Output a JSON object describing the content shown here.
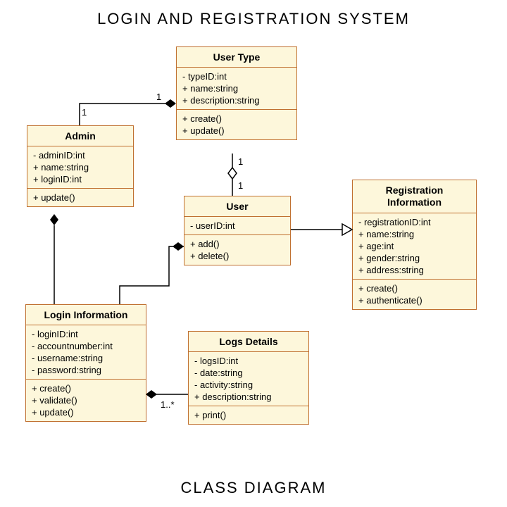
{
  "title": "LOGIN AND REGISTRATION SYSTEM",
  "footer": "CLASS DIAGRAM",
  "classes": {
    "admin": {
      "name": "Admin",
      "attrs": [
        "- adminID:int",
        "+ name:string",
        "+ loginID:int"
      ],
      "ops": [
        "+ update()"
      ]
    },
    "usertype": {
      "name": "User Type",
      "attrs": [
        "- typeID:int",
        "+ name:string",
        "+ description:string"
      ],
      "ops": [
        "+ create()",
        "+ update()"
      ]
    },
    "user": {
      "name": "User",
      "attrs": [
        "- userID:int"
      ],
      "ops": [
        "+ add()",
        "+ delete()"
      ]
    },
    "registration": {
      "name": "Registration Information",
      "attrs": [
        "- registrationID:int",
        "+ name:string",
        "+ age:int",
        "+ gender:string",
        "+ address:string"
      ],
      "ops": [
        "+ create()",
        "+ authenticate()"
      ]
    },
    "login": {
      "name": "Login Information",
      "attrs": [
        "- loginID:int",
        "- accountnumber:int",
        "- username:string",
        "- password:string"
      ],
      "ops": [
        "+ create()",
        "+ validate()",
        "+ update()"
      ]
    },
    "logs": {
      "name": "Logs Details",
      "attrs": [
        "- logsID:int",
        "- date:string",
        "- activity:string",
        "+ description:string"
      ],
      "ops": [
        "+ print()"
      ]
    }
  },
  "multiplicities": {
    "admin_usertype_admin": "1",
    "admin_usertype_type": "1",
    "usertype_user_type": "1",
    "usertype_user_user": "1",
    "login_logs": "1..*"
  },
  "relationships": [
    {
      "from": "Admin",
      "to": "User Type",
      "type": "composition",
      "owner": "User Type",
      "mult_from": "1",
      "mult_to": "1"
    },
    {
      "from": "User Type",
      "to": "User",
      "type": "aggregation",
      "owner": "User",
      "mult_from": "1",
      "mult_to": "1"
    },
    {
      "from": "User",
      "to": "Registration Information",
      "type": "generalization",
      "direction": "User extends Registration Information"
    },
    {
      "from": "Login Information",
      "to": "Admin",
      "type": "composition",
      "owner": "Admin"
    },
    {
      "from": "Login Information",
      "to": "User",
      "type": "composition",
      "owner": "User"
    },
    {
      "from": "Login Information",
      "to": "Logs Details",
      "type": "composition",
      "owner": "Login Information",
      "mult_to": "1..*"
    }
  ]
}
